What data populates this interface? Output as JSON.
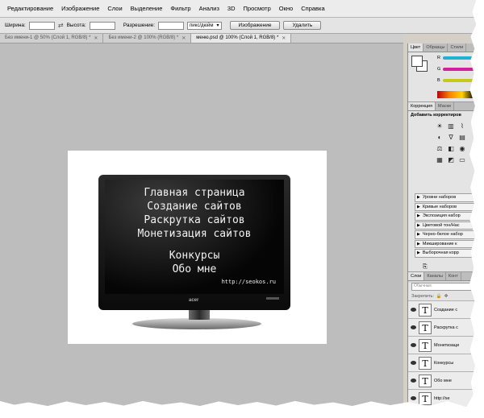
{
  "menu": [
    "Редактирование",
    "Изображение",
    "Слои",
    "Выделение",
    "Фильтр",
    "Анализ",
    "3D",
    "Просмотр",
    "Окно",
    "Справка"
  ],
  "options": {
    "width_label": "Ширина:",
    "height_label": "Высота:",
    "resolution_label": "Разрешение:",
    "resolution_unit": "пикс/дюйм",
    "image_button": "Изображение",
    "delete_button": "Удалить"
  },
  "doc_tabs": [
    {
      "label": "Без имени-1 @ 50% (Слой 1, RGB/8) *",
      "active": false
    },
    {
      "label": "Без имени-2 @ 100% (RGB/8) *",
      "active": false
    },
    {
      "label": "меню.psd @ 100% (Слой 1, RGB/8) *",
      "active": true
    }
  ],
  "screen": {
    "menu_items": [
      "Главная страница",
      "Создание сайтов",
      "Раскрутка сайтов",
      "Монетизация сайтов"
    ],
    "menu_items2": [
      "Конкурсы",
      "Обо мне"
    ],
    "url": "http://seokos.ru",
    "brand": "acer"
  },
  "panels": {
    "color_tabs": [
      "Цвет",
      "Образцы",
      "Стили"
    ],
    "color_rows": [
      {
        "label": "R",
        "color": "#20b0d0"
      },
      {
        "label": "G",
        "color": "#d020a0"
      },
      {
        "label": "B",
        "color": "#c8c818"
      }
    ],
    "corr_tabs": [
      "Коррекция",
      "Маски"
    ],
    "corr_title": "Добавить корректиров",
    "presets": [
      "Уровни наборов",
      "Кривые наборов",
      "Экспозиция набор",
      "Цветовой тон/Нас",
      "Черно-белое набор",
      "Микширование к",
      "Выборочная корр"
    ],
    "layers_tabs": [
      "Слои",
      "Каналы",
      "Конт"
    ],
    "layers_search": "Обычные",
    "layers_lock": "Закрепить:",
    "layers": [
      "Создание с",
      "Раскрутка с",
      "Монетизаци",
      "Конкурсы",
      "Обо мне",
      "http://se"
    ]
  }
}
